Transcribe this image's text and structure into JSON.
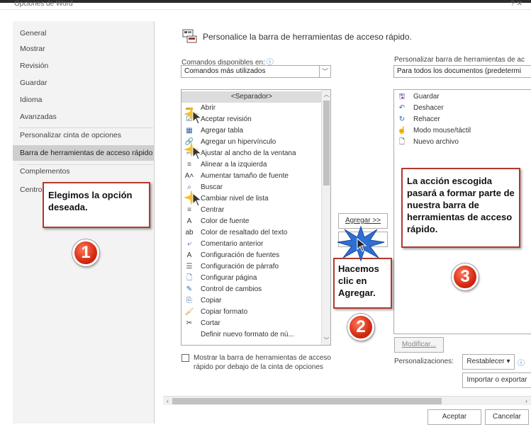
{
  "window": {
    "title": "Opciones de Word",
    "controls": "?  ✕",
    "accent_color": "#b03a2e"
  },
  "sidebar": {
    "items": [
      {
        "label": "General"
      },
      {
        "label": "Mostrar"
      },
      {
        "label": "Revisión"
      },
      {
        "label": "Guardar"
      },
      {
        "label": "Idioma"
      },
      {
        "label": "Avanzadas"
      },
      {
        "label": "Personalizar cinta de opciones"
      },
      {
        "label": "Barra de herramientas de acceso rápido"
      },
      {
        "label": "Complementos"
      },
      {
        "label": "Centro"
      }
    ],
    "selected_index": 7
  },
  "header": {
    "title": "Personalice la barra de herramientas de acceso rápido."
  },
  "commands": {
    "label": "Comandos disponibles en:",
    "dropdown_value": "Comandos más utilizados",
    "items": [
      {
        "label": "<Separador>",
        "icon": "separator"
      },
      {
        "label": "Abrir",
        "icon": "folder-icon"
      },
      {
        "label": "Aceptar revisión",
        "icon": "accept-icon"
      },
      {
        "label": "Agregar tabla",
        "icon": "table-icon",
        "submenu": true
      },
      {
        "label": "Agregar un hipervínculo",
        "icon": "link-icon"
      },
      {
        "label": "Ajustar al ancho de la ventana",
        "icon": "fit-width-icon"
      },
      {
        "label": "Alinear a la izquierda",
        "icon": "align-left-icon"
      },
      {
        "label": "Aumentar tamaño de fuente",
        "icon": "font-grow-icon"
      },
      {
        "label": "Buscar",
        "icon": "search-icon"
      },
      {
        "label": "Cambiar nivel de lista",
        "icon": "list-level-icon",
        "submenu": true
      },
      {
        "label": "Centrar",
        "icon": "align-center-icon"
      },
      {
        "label": "Color de fuente",
        "icon": "font-color-icon",
        "split": true
      },
      {
        "label": "Color de resaltado del texto",
        "icon": "highlight-icon",
        "split": true
      },
      {
        "label": "Comentario anterior",
        "icon": "comment-icon"
      },
      {
        "label": "Configuración de fuentes",
        "icon": "font-settings-icon"
      },
      {
        "label": "Configuración de párrafo",
        "icon": "paragraph-icon"
      },
      {
        "label": "Configurar página",
        "icon": "page-setup-icon"
      },
      {
        "label": "Control de cambios",
        "icon": "track-changes-icon"
      },
      {
        "label": "Copiar",
        "icon": "copy-icon"
      },
      {
        "label": "Copiar formato",
        "icon": "format-painter-icon"
      },
      {
        "label": "Cortar",
        "icon": "cut-icon"
      },
      {
        "label": "Definir nuevo formato de nú...",
        "icon": "numbering-icon"
      }
    ],
    "show_below_label": "Mostrar la barra de herramientas de acceso rápido por debajo de la cinta de opciones"
  },
  "toolbar": {
    "label": "Personalizar barra de herramientas de ac",
    "dropdown_value": "Para todos los documentos (predetermi",
    "items": [
      {
        "label": "Guardar",
        "icon": "save-icon"
      },
      {
        "label": "Deshacer",
        "icon": "undo-icon"
      },
      {
        "label": "Rehacer",
        "icon": "redo-icon"
      },
      {
        "label": "Modo mouse/táctil",
        "icon": "touch-icon"
      },
      {
        "label": "Nuevo archivo",
        "icon": "new-file-icon"
      }
    ],
    "modify_label": "Modificar...",
    "customizations_label": "Personalizaciones:",
    "reset_label": "Restablecer ▾",
    "import_label": "Importar o exportar"
  },
  "actions": {
    "add_label": "Agregar >>",
    "ok_label": "Aceptar",
    "cancel_label": "Cancelar"
  },
  "callouts": {
    "one": "Elegimos la opción deseada.",
    "two": "Hacemos clic en Agregar.",
    "three": "La acción escogida pasará a formar parte de nuestra barra de herramientas de acceso rápido."
  },
  "badges": {
    "one": "1",
    "two": "2",
    "three": "3"
  }
}
